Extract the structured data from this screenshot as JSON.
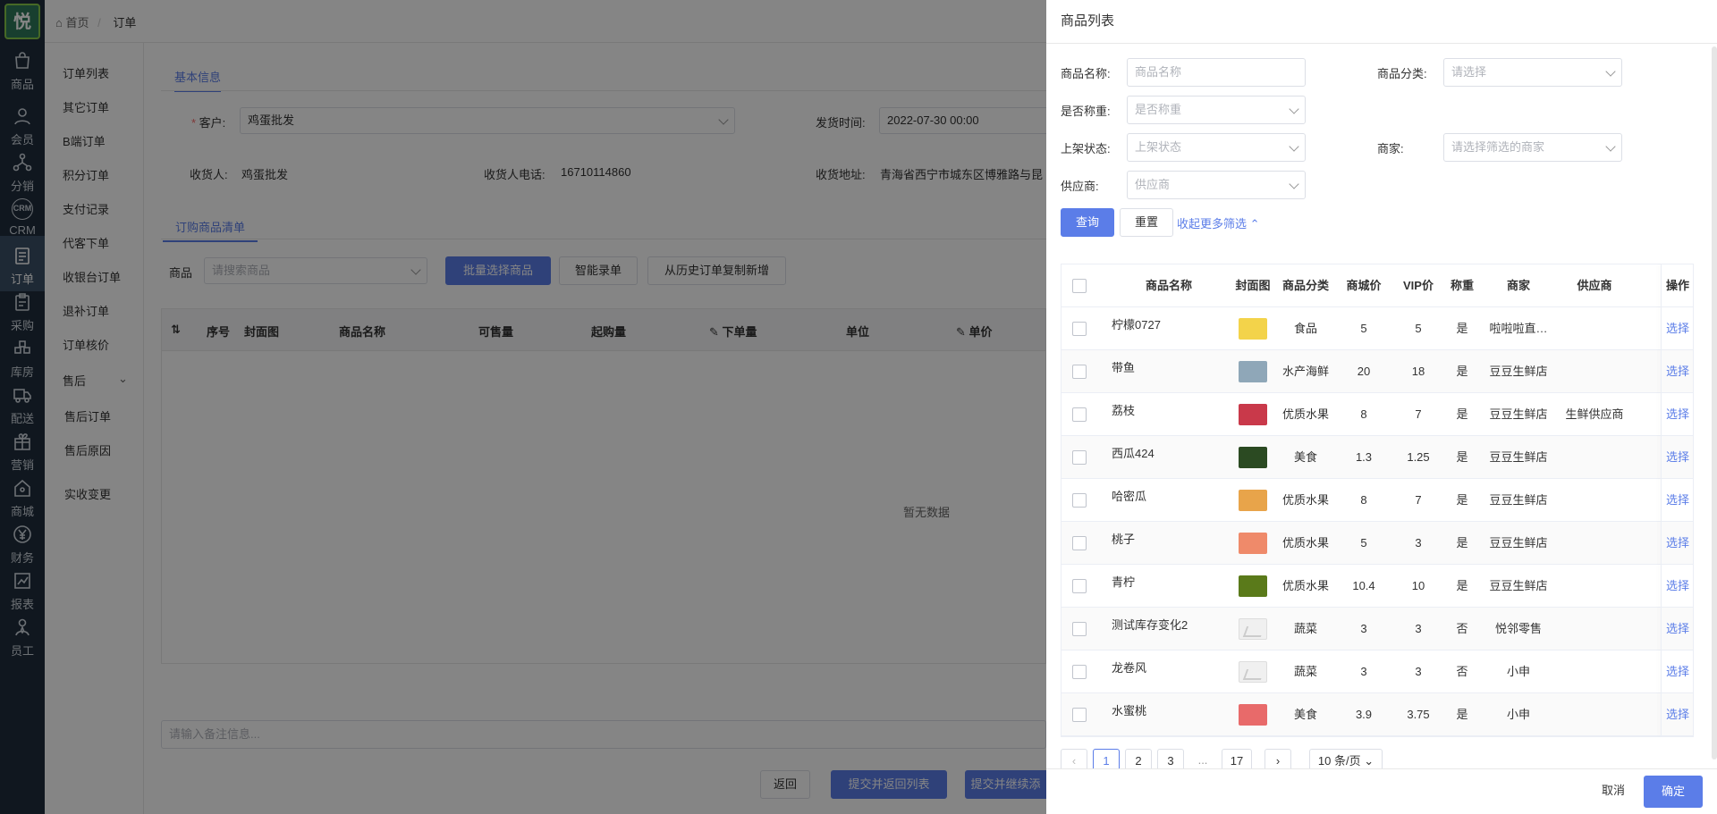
{
  "rail": {
    "logo": "悦",
    "items": [
      {
        "label": "商品",
        "icon": "bag-icon"
      },
      {
        "label": "会员",
        "icon": "user-icon"
      },
      {
        "label": "分销",
        "icon": "share-icon"
      },
      {
        "label": "CRM",
        "icon": "crm-icon"
      },
      {
        "label": "订单",
        "icon": "order-icon"
      },
      {
        "label": "采购",
        "icon": "clipboard-icon"
      },
      {
        "label": "库房",
        "icon": "warehouse-icon"
      },
      {
        "label": "配送",
        "icon": "truck-icon"
      },
      {
        "label": "营销",
        "icon": "gift-icon"
      },
      {
        "label": "商城",
        "icon": "store-icon"
      },
      {
        "label": "财务",
        "icon": "yen-icon"
      },
      {
        "label": "报表",
        "icon": "chart-icon"
      },
      {
        "label": "员工",
        "icon": "staff-icon"
      }
    ]
  },
  "submenu": {
    "items": [
      "订单列表",
      "其它订单",
      "B端订单",
      "积分订单",
      "支付记录",
      "代客下单",
      "收银台订单",
      "退补订单",
      "订单核价",
      "售后",
      "售后订单",
      "售后原因",
      "实收变更"
    ],
    "collapse": "收起"
  },
  "breadcrumb": {
    "home": "首页",
    "current": "订单"
  },
  "basic": {
    "tab": "基本信息",
    "customer_label": "客户:",
    "customer_value": "鸡蛋批发",
    "ship_label": "发货时间:",
    "ship_value": "2022-07-30 00:00",
    "receiver_label": "收货人:",
    "receiver_value": "鸡蛋批发",
    "phone_label": "收货人电话:",
    "phone_value": "16710114860",
    "address_label": "收货地址:",
    "address_value": "青海省西宁市城东区博雅路与昆"
  },
  "goods": {
    "tab": "订购商品清单",
    "product_label": "商品",
    "search_placeholder": "请搜索商品",
    "batch_btn": "批量选择商品",
    "smart_btn": "智能录单",
    "history_btn": "从历史订单复制新增",
    "headers": [
      "序号",
      "封面图",
      "商品名称",
      "可售量",
      "起购量",
      "下单量",
      "单位",
      "单价"
    ],
    "empty": "暂无数据",
    "remark_placeholder": "请输入备注信息..."
  },
  "bottom": {
    "back": "返回",
    "submit_list": "提交并返回列表",
    "submit_continue": "提交并继续添"
  },
  "drawer": {
    "title": "商品列表",
    "filters": {
      "name_label": "商品名称:",
      "name_placeholder": "商品名称",
      "category_label": "商品分类:",
      "category_placeholder": "请选择",
      "weigh_label": "是否称重:",
      "weigh_placeholder": "是否称重",
      "status_label": "上架状态:",
      "status_placeholder": "上架状态",
      "merchant_label": "商家:",
      "merchant_placeholder": "请选择筛选的商家",
      "supplier_label": "供应商:",
      "supplier_placeholder": "供应商"
    },
    "query_btn": "查询",
    "reset_btn": "重置",
    "collapse_filter": "收起更多筛选",
    "table_headers": [
      "商品名称",
      "封面图",
      "商品分类",
      "商城价",
      "VIP价",
      "称重",
      "商家",
      "供应商",
      "操作"
    ],
    "rows": [
      {
        "name": "柠檬0727",
        "category": "食品",
        "price": "5",
        "vip": "5",
        "weigh": "是",
        "merchant": "啦啦啦直…",
        "supplier": "",
        "action": "选择",
        "thumb": "#f3d34a"
      },
      {
        "name": "带鱼",
        "category": "水产海鲜",
        "price": "20",
        "vip": "18",
        "weigh": "是",
        "merchant": "豆豆生鲜店",
        "supplier": "",
        "action": "选择",
        "thumb": "#8fa7b8"
      },
      {
        "name": "荔枝",
        "category": "优质水果",
        "price": "8",
        "vip": "7",
        "weigh": "是",
        "merchant": "豆豆生鲜店",
        "supplier": "生鲜供应商",
        "action": "选择",
        "thumb": "#c9394a"
      },
      {
        "name": "西瓜424",
        "category": "美食",
        "price": "1.3",
        "vip": "1.25",
        "weigh": "是",
        "merchant": "豆豆生鲜店",
        "supplier": "",
        "action": "选择",
        "thumb": "#2b4a22"
      },
      {
        "name": "哈密瓜",
        "category": "优质水果",
        "price": "8",
        "vip": "7",
        "weigh": "是",
        "merchant": "豆豆生鲜店",
        "supplier": "",
        "action": "选择",
        "thumb": "#e8a44a"
      },
      {
        "name": "桃子",
        "category": "优质水果",
        "price": "5",
        "vip": "3",
        "weigh": "是",
        "merchant": "豆豆生鲜店",
        "supplier": "",
        "action": "选择",
        "thumb": "#ef8a6a"
      },
      {
        "name": "青柠",
        "category": "优质水果",
        "price": "10.4",
        "vip": "10",
        "weigh": "是",
        "merchant": "豆豆生鲜店",
        "supplier": "",
        "action": "选择",
        "thumb": "#5a7a1a"
      },
      {
        "name": "测试库存变化2",
        "category": "蔬菜",
        "price": "3",
        "vip": "3",
        "weigh": "否",
        "merchant": "悦邻零售",
        "supplier": "",
        "action": "选择",
        "thumb": ""
      },
      {
        "name": "龙卷风",
        "category": "蔬菜",
        "price": "3",
        "vip": "3",
        "weigh": "否",
        "merchant": "小申",
        "supplier": "",
        "action": "选择",
        "thumb": ""
      },
      {
        "name": "水蜜桃",
        "category": "美食",
        "price": "3.9",
        "vip": "3.75",
        "weigh": "是",
        "merchant": "小申",
        "supplier": "",
        "action": "选择",
        "thumb": "#e86a6a"
      }
    ],
    "pager": {
      "pages": [
        "1",
        "2",
        "3",
        "...",
        "17"
      ],
      "size": "10 条/页"
    },
    "cancel": "取消",
    "confirm": "确定"
  },
  "colors": {
    "accent": "#5b7de8",
    "rail": "#1f2d3d"
  }
}
